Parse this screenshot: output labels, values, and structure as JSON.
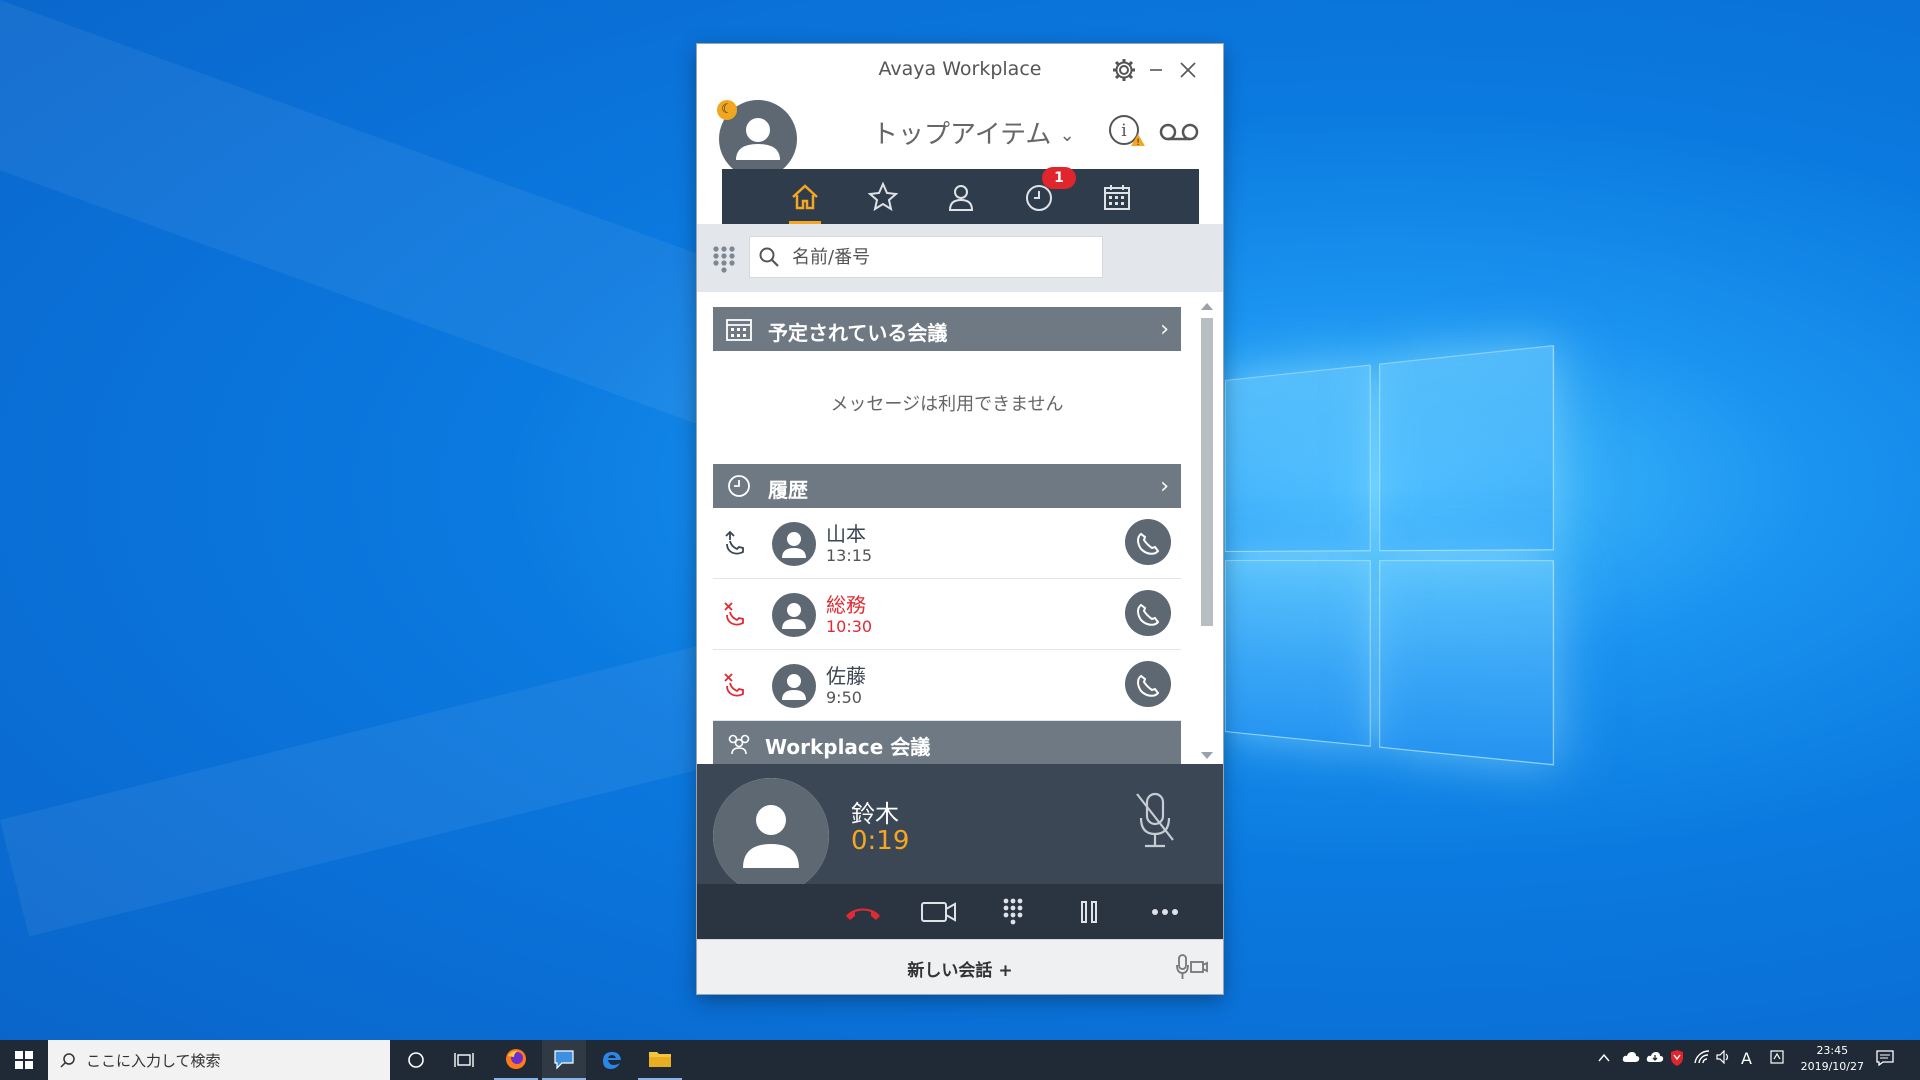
{
  "app": {
    "title": "Avaya Workplace",
    "header_dropdown": "トップアイテム",
    "nav": {
      "badge_count": "1"
    },
    "search": {
      "placeholder": "名前/番号"
    },
    "sections": {
      "meetings": {
        "label": "予定されている会議",
        "empty": "メッセージは利用できません"
      },
      "history": {
        "label": "履歴"
      },
      "workplace_meetings": {
        "label": "Workplace 会議"
      }
    },
    "history_items": [
      {
        "name": "山本",
        "time": "13:15",
        "type": "outgoing"
      },
      {
        "name": "総務",
        "time": "10:30",
        "type": "missed"
      },
      {
        "name": "佐藤",
        "time": "9:50",
        "type": "missed"
      }
    ],
    "active_call": {
      "name": "鈴木",
      "duration": "0:19"
    },
    "footer": {
      "new_conversation": "新しい会話 +"
    },
    "colors": {
      "accent": "#f5a623",
      "missed": "#e22a33",
      "nav_bg": "#2f3c4b",
      "section_bg": "#6f7984"
    }
  },
  "taskbar": {
    "search_placeholder": "ここに入力して検索",
    "ime": "A",
    "clock_time": "23:45",
    "clock_date": "2019/10/27"
  }
}
